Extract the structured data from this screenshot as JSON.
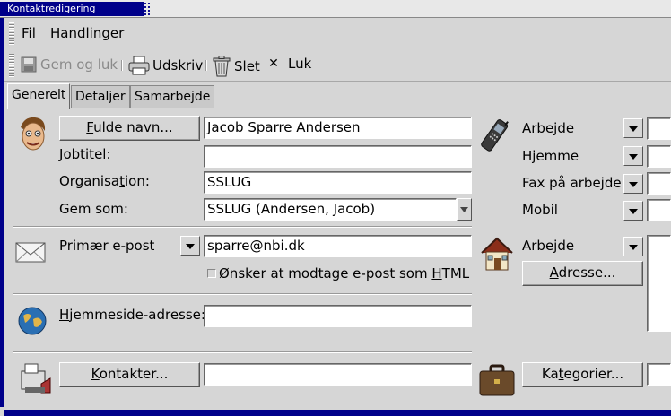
{
  "window": {
    "title": "Kontaktredigering"
  },
  "menubar": {
    "file": "Fil",
    "actions": "Handlinger"
  },
  "toolbar": {
    "save_close": "Gem og luk",
    "print": "Udskriv",
    "delete": "Slet",
    "close": "Luk"
  },
  "tabs": [
    {
      "label": "Generelt",
      "active": true
    },
    {
      "label": "Detaljer"
    },
    {
      "label": "Samarbejde"
    }
  ],
  "general": {
    "full_name_button": "Fulde navn...",
    "full_name_value": "Jacob Sparre Andersen",
    "job_title_label": "Jobtitel:",
    "job_title_value": "",
    "organization_label": "Organisation:",
    "organization_value": "SSLUG",
    "file_as_label": "Gem som:",
    "file_as_value": "SSLUG (Andersen, Jacob)",
    "primary_email_label": "Primær e-post",
    "primary_email_value": "sparre@nbi.dk",
    "html_mail_label": "Ønsker at modtage e-post som HTML",
    "homepage_label": "Hjemmeside-adresse:",
    "homepage_value": "",
    "contacts_button": "Kontakter...",
    "contacts_value": ""
  },
  "phones": [
    {
      "label": "Arbejde"
    },
    {
      "label": "Hjemme"
    },
    {
      "label": "Fax på arbejde"
    },
    {
      "label": "Mobil"
    }
  ],
  "address": {
    "type_label": "Arbejde",
    "button": "Adresse..."
  },
  "categories": {
    "button": "Kategorier..."
  },
  "colors": {
    "title_bar": "#00008a",
    "window_bg": "#d6d6d6",
    "field_bg": "#ffffff"
  },
  "icons": [
    "save-icon",
    "printer-icon",
    "trash-icon",
    "close-x-icon",
    "person-face-icon",
    "cellphone-icon",
    "envelope-icon",
    "house-icon",
    "globe-icon",
    "contacts-icon",
    "briefcase-icon"
  ]
}
